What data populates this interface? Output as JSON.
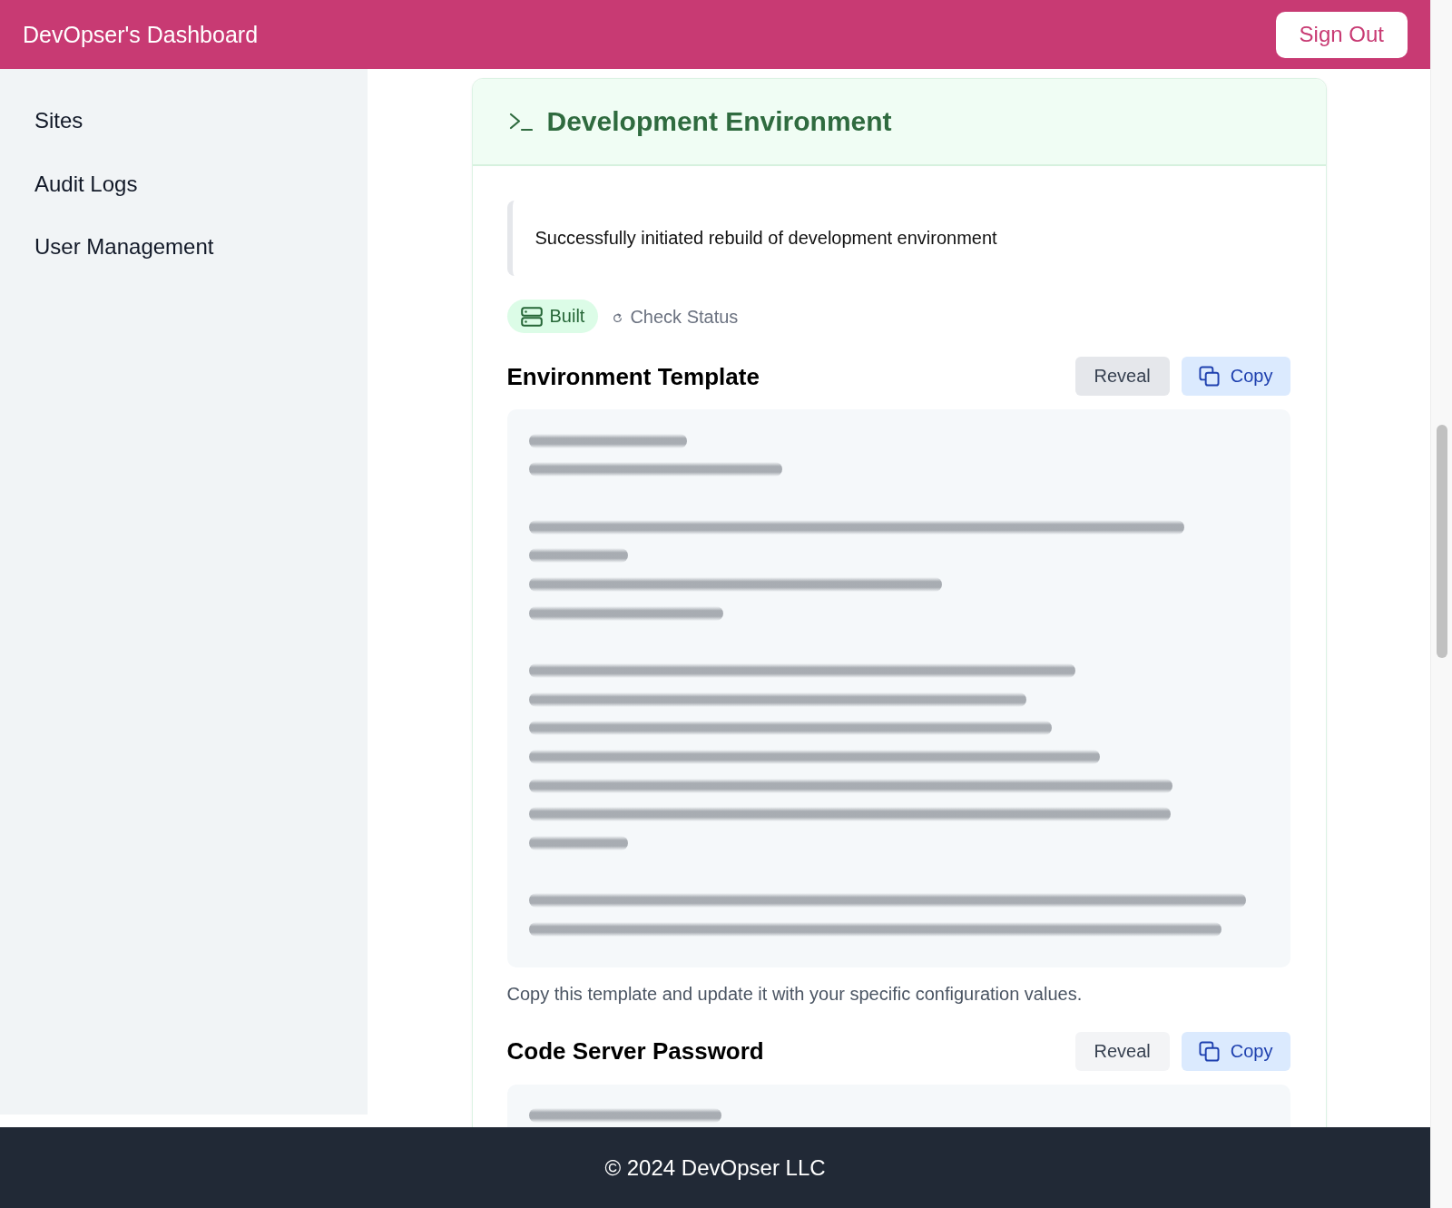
{
  "header": {
    "title": "DevOpser's Dashboard",
    "sign_out": "Sign Out"
  },
  "sidebar": {
    "items": [
      {
        "label": "Sites"
      },
      {
        "label": "Audit Logs"
      },
      {
        "label": "User Management"
      }
    ]
  },
  "card": {
    "title": "Development Environment",
    "alert": "Successfully initiated rebuild of development environment",
    "status": {
      "kind": "built",
      "label": "Built"
    },
    "check_status": {
      "label": "Check Status"
    },
    "sections": [
      {
        "title": "Environment Template",
        "reveal": {
          "label": "Reveal",
          "hovered": true
        },
        "copy": {
          "label": "Copy"
        },
        "masked": true,
        "note": "Copy this template and update it with your specific configuration values."
      },
      {
        "title": "Code Server Password",
        "reveal": {
          "label": "Reveal",
          "hovered": false
        },
        "copy": {
          "label": "Copy"
        },
        "masked": true
      }
    ]
  },
  "footer": {
    "text": "© 2024 DevOpser LLC"
  }
}
